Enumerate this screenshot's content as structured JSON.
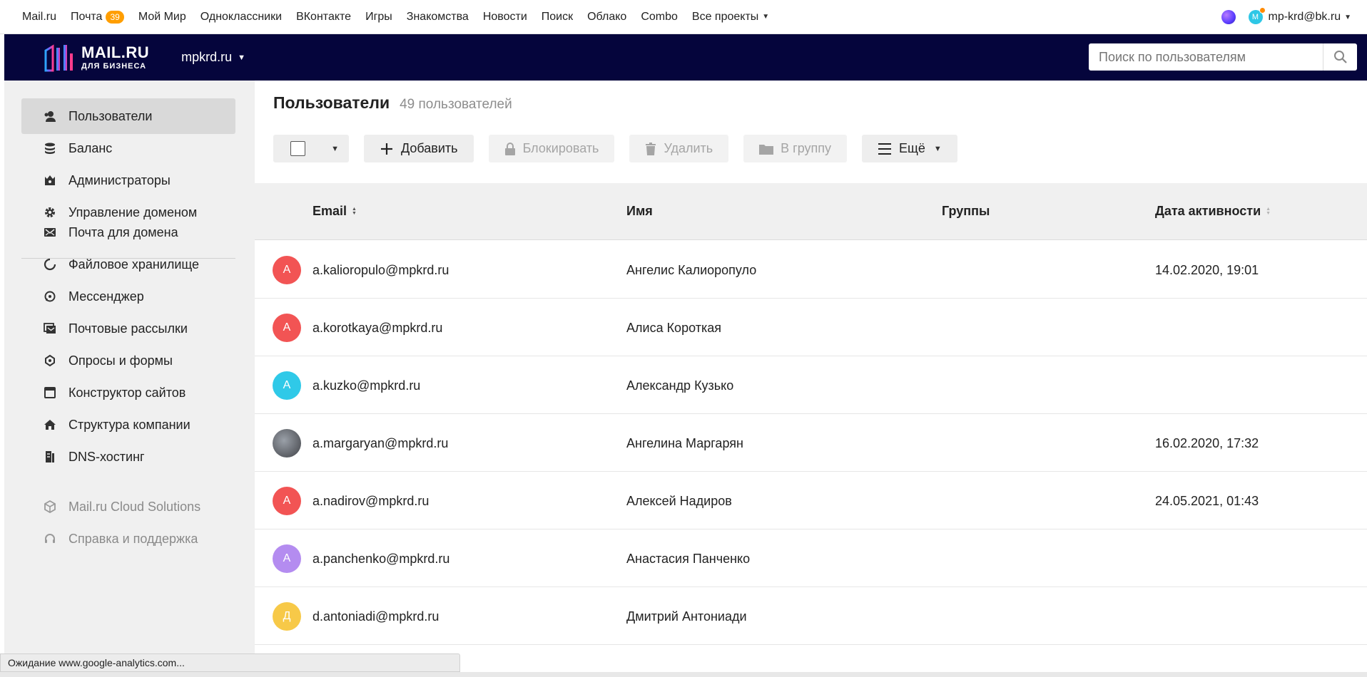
{
  "portal": {
    "links": [
      "Mail.ru",
      "Почта",
      "Мой Мир",
      "Одноклассники",
      "ВКонтакте",
      "Игры",
      "Знакомства",
      "Новости",
      "Поиск",
      "Облако",
      "Combo",
      "Все проекты"
    ],
    "mail_badge": "39",
    "user_email": "mp-krd@bk.ru",
    "user_avatar_letter": "М"
  },
  "header": {
    "logo_line1": "MAIL.RU",
    "logo_line2": "ДЛЯ БИЗНЕСА",
    "domain": "mpkrd.ru",
    "search_placeholder": "Поиск по пользователям"
  },
  "sidebar": {
    "items": [
      {
        "label": "Пользователи",
        "icon": "user-icon"
      },
      {
        "label": "Баланс",
        "icon": "coins-icon"
      },
      {
        "label": "Администраторы",
        "icon": "crown-icon"
      },
      {
        "label": "Управление доменом",
        "icon": "gear-icon"
      },
      {
        "label": "Почта для домена",
        "icon": "mail-icon"
      },
      {
        "label": "Файловое хранилище",
        "icon": "cloud-icon"
      },
      {
        "label": "Мессенджер",
        "icon": "chat-icon"
      },
      {
        "label": "Почтовые рассылки",
        "icon": "newsletter-icon"
      },
      {
        "label": "Опросы и формы",
        "icon": "form-icon"
      },
      {
        "label": "Конструктор сайтов",
        "icon": "browser-icon"
      },
      {
        "label": "Структура компании",
        "icon": "home-icon"
      },
      {
        "label": "DNS-хостинг",
        "icon": "server-icon"
      },
      {
        "label": "Mail.ru Cloud Solutions",
        "icon": "cube-icon"
      },
      {
        "label": "Справка и поддержка",
        "icon": "headset-icon"
      }
    ]
  },
  "main": {
    "title": "Пользователи",
    "count": "49 пользователей",
    "toolbar": {
      "add": "Добавить",
      "block": "Блокировать",
      "delete": "Удалить",
      "to_group": "В группу",
      "more": "Ещё"
    },
    "columns": {
      "email": "Email",
      "name": "Имя",
      "groups": "Группы",
      "activity": "Дата активности"
    },
    "rows": [
      {
        "letter": "А",
        "color": "#f25454",
        "email": "a.kalioropulo@mpkrd.ru",
        "name": "Ангелис Калиоропуло",
        "groups": "",
        "activity": "14.02.2020, 19:01"
      },
      {
        "letter": "А",
        "color": "#f25454",
        "email": "a.korotkaya@mpkrd.ru",
        "name": "Алиса Короткая",
        "groups": "",
        "activity": ""
      },
      {
        "letter": "А",
        "color": "#2fc9e8",
        "email": "a.kuzko@mpkrd.ru",
        "name": "Александр Кузько",
        "groups": "",
        "activity": ""
      },
      {
        "letter": "",
        "color": "#6b6e74",
        "email": "a.margaryan@mpkrd.ru",
        "name": "Ангелина Маргарян",
        "groups": "",
        "activity": "16.02.2020, 17:32"
      },
      {
        "letter": "А",
        "color": "#f25454",
        "email": "a.nadirov@mpkrd.ru",
        "name": "Алексей Надиров",
        "groups": "",
        "activity": "24.05.2021, 01:43"
      },
      {
        "letter": "А",
        "color": "#b48cf0",
        "email": "a.panchenko@mpkrd.ru",
        "name": "Анастасия Панченко",
        "groups": "",
        "activity": ""
      },
      {
        "letter": "Д",
        "color": "#f7c948",
        "email": "d.antoniadi@mpkrd.ru",
        "name": "Дмитрий Антониади",
        "groups": "",
        "activity": ""
      }
    ]
  },
  "status": "Ожидание www.google-analytics.com..."
}
